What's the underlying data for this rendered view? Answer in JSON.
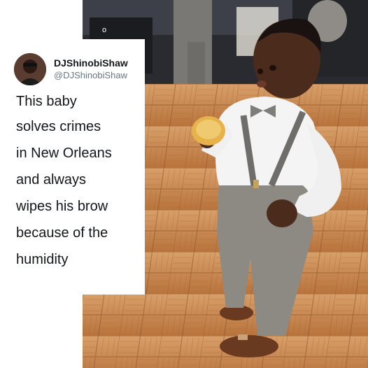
{
  "tweet": {
    "display_name": "DJShinobiShaw",
    "handle": "@DJShinobiShaw",
    "avatar_icon": "user-avatar-icon",
    "lines": [
      "This baby",
      "solves crimes",
      "in New Orleans",
      "and always",
      "wipes his brow",
      "because of the",
      "humidity"
    ]
  },
  "photo": {
    "top_mark": "o",
    "description_icon": "toddler-photo"
  },
  "colors": {
    "floor": "#c8854a",
    "shirt": "#f4f4f4",
    "pants": "#8d8a84",
    "skin": "#4a2b1c",
    "shoes": "#6a3a20",
    "handle_gray": "#657786"
  }
}
